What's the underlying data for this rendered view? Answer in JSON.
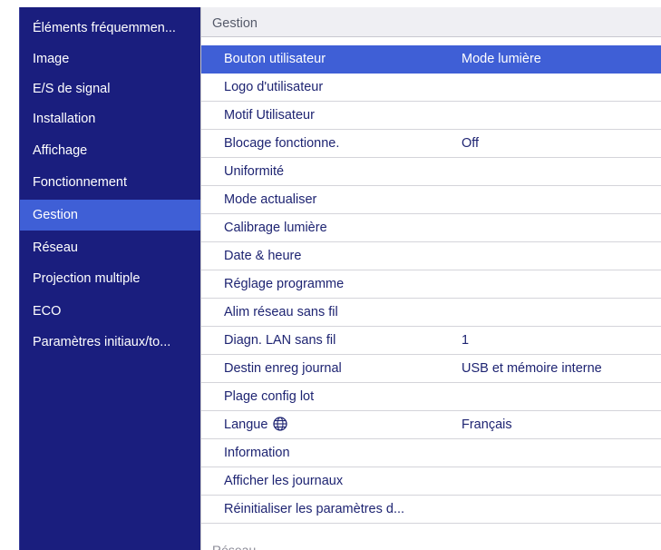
{
  "sidebar": {
    "items": [
      {
        "label": "Éléments fréquemmen...",
        "active": false
      },
      {
        "label": "Image",
        "active": false
      },
      {
        "label": "E/S de signal",
        "active": false
      },
      {
        "label": "Installation",
        "active": false
      },
      {
        "label": "Affichage",
        "active": false
      },
      {
        "label": "Fonctionnement",
        "active": false
      },
      {
        "label": "Gestion",
        "active": true
      },
      {
        "label": "Réseau",
        "active": false
      },
      {
        "label": "Projection multiple",
        "active": false
      },
      {
        "label": "ECO",
        "active": false
      },
      {
        "label": "Paramètres initiaux/to...",
        "active": false
      }
    ]
  },
  "main": {
    "section_title": "Gestion",
    "rows": [
      {
        "label": "Bouton utilisateur",
        "value": "Mode lumière",
        "selected": true
      },
      {
        "label": "Logo d'utilisateur",
        "value": ""
      },
      {
        "label": "Motif Utilisateur",
        "value": ""
      },
      {
        "label": "Blocage fonctionne.",
        "value": "Off"
      },
      {
        "label": "Uniformité",
        "value": ""
      },
      {
        "label": "Mode actualiser",
        "value": ""
      },
      {
        "label": "Calibrage lumière",
        "value": ""
      },
      {
        "label": "Date & heure",
        "value": ""
      },
      {
        "label": "Réglage programme",
        "value": ""
      },
      {
        "label": "Alim réseau sans fil",
        "value": ""
      },
      {
        "label": "Diagn. LAN sans fil",
        "value": "1"
      },
      {
        "label": "Destin enreg journal",
        "value": "USB et mémoire interne"
      },
      {
        "label": "Plage config lot",
        "value": ""
      },
      {
        "label": "Langue",
        "value": "Français",
        "icon": "globe-icon"
      },
      {
        "label": "Information",
        "value": ""
      },
      {
        "label": "Afficher les journaux",
        "value": ""
      },
      {
        "label": "Réinitialiser les paramètres d...",
        "value": ""
      }
    ],
    "next_section_title": "Réseau"
  },
  "colors": {
    "sidebar_bg": "#1a1e7e",
    "highlight": "#3f5fd6",
    "row_text": "#1e2472"
  }
}
